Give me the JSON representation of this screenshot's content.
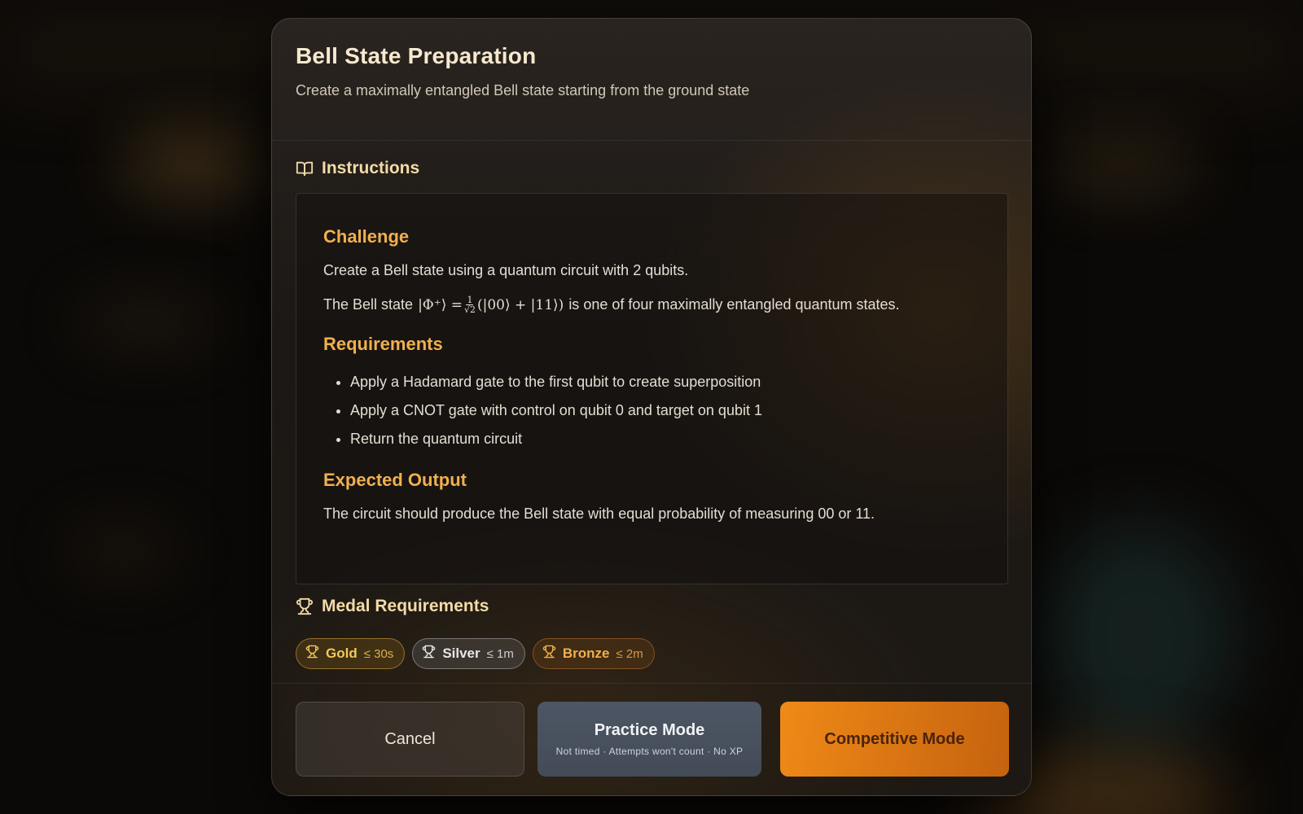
{
  "dialog": {
    "title": "Bell State Preparation",
    "subtitle": "Create a maximally entangled Bell state starting from the ground state"
  },
  "instructions": {
    "heading": "Instructions",
    "icon": "book-open-icon",
    "challenge_heading": "Challenge",
    "challenge_text": "Create a Bell state using a quantum circuit with 2 qubits.",
    "bell_text_before": "The Bell state",
    "bell_formula_lhs": "|Φ⁺⟩ =",
    "bell_formula_frac_num": "1",
    "bell_formula_frac_den": "√2",
    "bell_formula_rhs": "(|00⟩ + |11⟩)",
    "bell_text_after": "is one of four maximally entangled quantum states.",
    "requirements_heading": "Requirements",
    "requirements": [
      "Apply a Hadamard gate to the first qubit to create superposition",
      "Apply a CNOT gate with control on qubit 0 and target on qubit 1",
      "Return the quantum circuit"
    ],
    "expected_heading": "Expected Output",
    "expected_text": "The circuit should produce the Bell state with equal probability of measuring 00 or 11."
  },
  "medals": {
    "heading": "Medal Requirements",
    "icon": "trophy-icon",
    "items": [
      {
        "name": "Gold",
        "requirement": "≤ 30s",
        "color": "#f2c75a"
      },
      {
        "name": "Silver",
        "requirement": "≤ 1m",
        "color": "#e6e6ea"
      },
      {
        "name": "Bronze",
        "requirement": "≤ 2m",
        "color": "#f0b04e"
      }
    ]
  },
  "footer": {
    "cancel_label": "Cancel",
    "practice_label": "Practice Mode",
    "practice_sub": "Not timed · Attempts won't count · No XP",
    "competitive_label": "Competitive Mode"
  },
  "colors": {
    "accent": "#f0b04e",
    "competitive": "#ef8a17",
    "practice": "#4d5664"
  }
}
